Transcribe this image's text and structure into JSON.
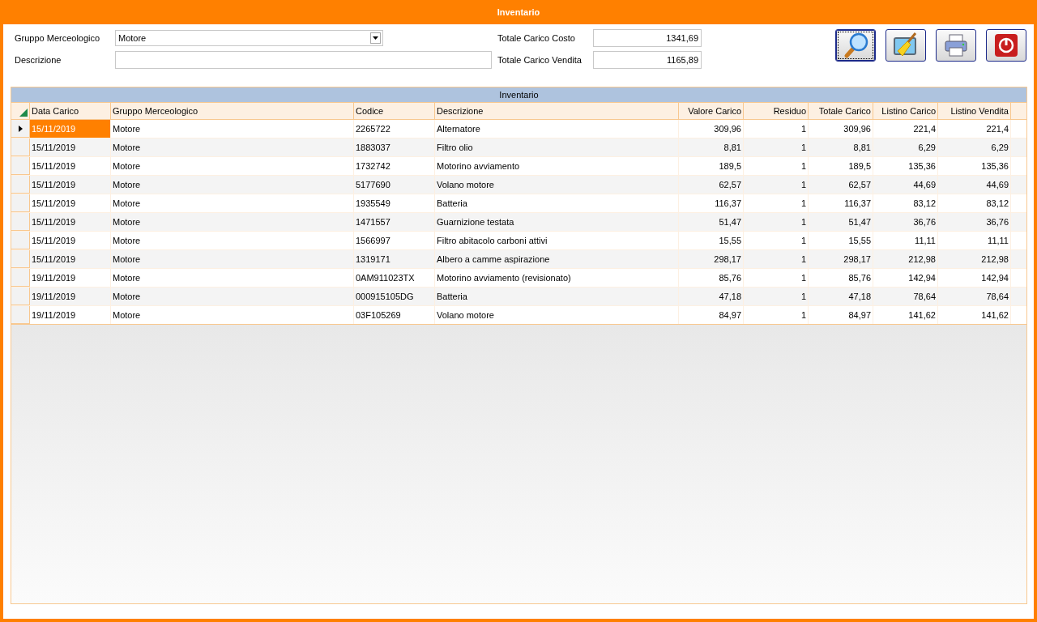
{
  "window": {
    "title": "Inventario"
  },
  "filters": {
    "group_label": "Gruppo Merceologico",
    "group_value": "Motore",
    "description_label": "Descrizione"
  },
  "totals": [
    {
      "label": "Totale Carico Costo",
      "value": "1341,69"
    },
    {
      "label": "Totale Carico Vendita",
      "value": "1165,89"
    }
  ],
  "toolbar": [
    {
      "kind": "search",
      "focused": true
    },
    {
      "kind": "clear",
      "focused": false
    },
    {
      "kind": "print",
      "focused": false
    },
    {
      "kind": "exit",
      "focused": false
    }
  ],
  "grid": {
    "title": "Inventario",
    "columns": [
      "Data Carico",
      "Gruppo Merceologico",
      "Codice",
      "Descrizione",
      "Valore Carico",
      "Residuo",
      "Totale Carico",
      "Listino Carico",
      "Listino Vendita"
    ],
    "rows": [
      {
        "selected": true,
        "cells": [
          "15/11/2019",
          "Motore",
          "2265722",
          "Alternatore",
          "309,96",
          "1",
          "309,96",
          "221,4",
          "221,4"
        ]
      },
      {
        "selected": false,
        "cells": [
          "15/11/2019",
          "Motore",
          "1883037",
          "Filtro olio",
          "8,81",
          "1",
          "8,81",
          "6,29",
          "6,29"
        ]
      },
      {
        "selected": false,
        "cells": [
          "15/11/2019",
          "Motore",
          "1732742",
          "Motorino avviamento",
          "189,5",
          "1",
          "189,5",
          "135,36",
          "135,36"
        ]
      },
      {
        "selected": false,
        "cells": [
          "15/11/2019",
          "Motore",
          "5177690",
          "Volano motore",
          "62,57",
          "1",
          "62,57",
          "44,69",
          "44,69"
        ]
      },
      {
        "selected": false,
        "cells": [
          "15/11/2019",
          "Motore",
          "1935549",
          "Batteria",
          "116,37",
          "1",
          "116,37",
          "83,12",
          "83,12"
        ]
      },
      {
        "selected": false,
        "cells": [
          "15/11/2019",
          "Motore",
          "1471557",
          "Guarnizione testata",
          "51,47",
          "1",
          "51,47",
          "36,76",
          "36,76"
        ]
      },
      {
        "selected": false,
        "cells": [
          "15/11/2019",
          "Motore",
          "1566997",
          "Filtro abitacolo carboni attivi",
          "15,55",
          "1",
          "15,55",
          "11,11",
          "11,11"
        ]
      },
      {
        "selected": false,
        "cells": [
          "15/11/2019",
          "Motore",
          "1319171",
          "Albero a camme aspirazione",
          "298,17",
          "1",
          "298,17",
          "212,98",
          "212,98"
        ]
      },
      {
        "selected": false,
        "cells": [
          "19/11/2019",
          "Motore",
          "0AM911023TX",
          "Motorino avviamento (revisionato)",
          "85,76",
          "1",
          "85,76",
          "142,94",
          "142,94"
        ]
      },
      {
        "selected": false,
        "cells": [
          "19/11/2019",
          "Motore",
          "000915105DG",
          "Batteria",
          "47,18",
          "1",
          "47,18",
          "78,64",
          "78,64"
        ]
      },
      {
        "selected": false,
        "cells": [
          "19/11/2019",
          "Motore",
          "03F105269",
          "Volano motore",
          "84,97",
          "1",
          "84,97",
          "141,62",
          "141,62"
        ]
      }
    ]
  }
}
